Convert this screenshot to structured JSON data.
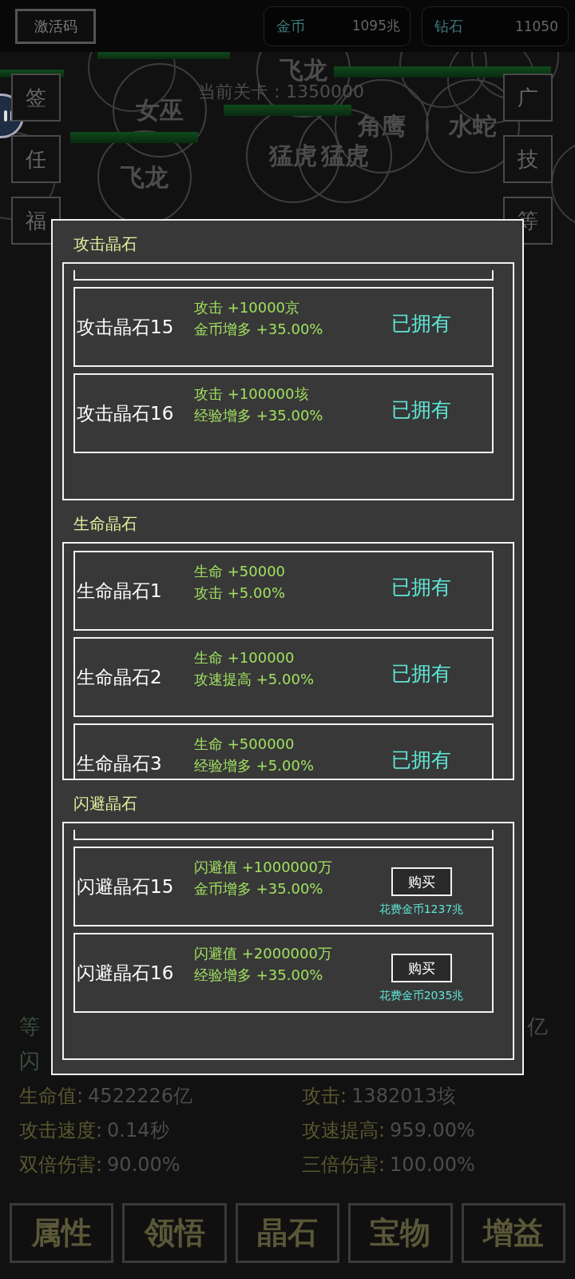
{
  "top_bar": {
    "activation_button": "激活码",
    "currencies": [
      {
        "label": "金币",
        "value": "1095兆"
      },
      {
        "label": "钻石",
        "value": "11050"
      }
    ]
  },
  "battle": {
    "stage": "当前关卡：1350000",
    "enemies": [
      "飞龙",
      "女巫",
      "角鹰",
      "水蛇",
      "猛虎",
      "猛虎",
      "飞龙"
    ],
    "left_buttons": [
      "签",
      "任",
      "福"
    ],
    "right_buttons": [
      "广",
      "技",
      "等"
    ]
  },
  "dialog": {
    "sections": [
      {
        "title": "攻击晶石",
        "items": [
          {
            "name": "攻击晶石15",
            "effects": [
              "攻击 +10000京",
              "金币增多 +35.00%"
            ],
            "owned": true,
            "status": "已拥有"
          },
          {
            "name": "攻击晶石16",
            "effects": [
              "攻击 +100000垓",
              "经验增多 +35.00%"
            ],
            "owned": true,
            "status": "已拥有"
          }
        ]
      },
      {
        "title": "生命晶石",
        "items": [
          {
            "name": "生命晶石1",
            "effects": [
              "生命 +50000",
              "攻击 +5.00%"
            ],
            "owned": true,
            "status": "已拥有"
          },
          {
            "name": "生命晶石2",
            "effects": [
              "生命 +100000",
              "攻速提高 +5.00%"
            ],
            "owned": true,
            "status": "已拥有"
          },
          {
            "name": "生命晶石3",
            "effects": [
              "生命 +500000",
              "经验增多 +5.00%"
            ],
            "owned": true,
            "status": "已拥有"
          }
        ]
      },
      {
        "title": "闪避晶石",
        "items": [
          {
            "name": "闪避晶石15",
            "effects": [
              "闪避值 +1000000万",
              "金币增多 +35.00%"
            ],
            "owned": false,
            "button": "购买",
            "cost": "花费金币1237兆"
          },
          {
            "name": "闪避晶石16",
            "effects": [
              "闪避值 +2000000万",
              "经验增多 +35.00%"
            ],
            "owned": false,
            "button": "购买",
            "cost": "花费金币2035兆"
          }
        ]
      }
    ]
  },
  "covered_stats": {
    "row_1_left": "等",
    "row_1_right": "亿",
    "row_2_left": "闪"
  },
  "stats": [
    {
      "label": "生命值:",
      "value": "4522226亿"
    },
    {
      "label": "攻击:",
      "value": "1382013垓"
    },
    {
      "label": "攻击速度:",
      "value": "0.14秒"
    },
    {
      "label": "攻速提高:",
      "value": "959.00%"
    },
    {
      "label": "双倍伤害:",
      "value": "90.00%"
    },
    {
      "label": "三倍伤害:",
      "value": "100.00%"
    }
  ],
  "tabs": [
    "属性",
    "领悟",
    "晶石",
    "宝物",
    "增益"
  ]
}
